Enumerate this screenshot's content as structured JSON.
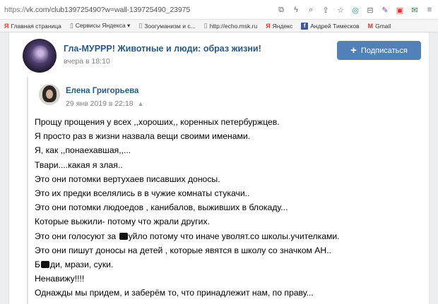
{
  "browser": {
    "url_proto": "https://",
    "url_rest": "vk.com/club139725490?w=wall-139725490_23975",
    "bookmarks": [
      {
        "label": "Главная страница",
        "icon": "yandex-logo-icon"
      },
      {
        "label": "Сервисы Яндекса ▾",
        "icon": "page-icon"
      },
      {
        "label": "Зоогуманизм и с...",
        "icon": "page-icon"
      },
      {
        "label": "http://echo.msk.ru",
        "icon": "page-icon"
      },
      {
        "label": "Яндекс",
        "icon": "yandex-logo-icon"
      },
      {
        "label": "Андрей Тимесков",
        "icon": "facebook-icon"
      },
      {
        "label": "Gmail",
        "icon": "gmail-icon"
      }
    ]
  },
  "group": {
    "name": "Гла-МУРРР! Животные и люди: образ жизни!",
    "date": "вчера в 18:10",
    "subscribe_label": "Подписаться"
  },
  "author": {
    "name": "Елена Григорьева",
    "date": "29 янв 2019 в 22:18"
  },
  "post_lines": [
    "Прощу прощения у всех ,,хороших,, коренных петербуржцев.",
    "Я просто раз в жизни назвала вещи своими именами.",
    "Я, как ,,понаехавшая,,...",
    "Твари....какая я злая..",
    "Это они потомки вертухаев писавших доносы.",
    "Это их предки вселялись в в чужие комнаты стукачи..",
    "Это они потомки людоедов , канибалов, выживших в блокаду...",
    "Которые выжили- потому что жрали других.",
    {
      "before": "Это они голосуют за ",
      "after": "уйло потому что иначе уволят.со школы.учителками."
    },
    "Это они пишут доносы на детей , которые явятся в школу со значком АН..",
    {
      "before": "Б",
      "after": "ди, мрази, суки."
    },
    "Ненавижу!!!!",
    "Однажды мы придем, и заберём то, что принадлежит нам, по праву..."
  ],
  "colors": {
    "link": "#2a5885",
    "button": "#5181b8",
    "muted": "#828282",
    "page_bg": "#edeef0"
  }
}
